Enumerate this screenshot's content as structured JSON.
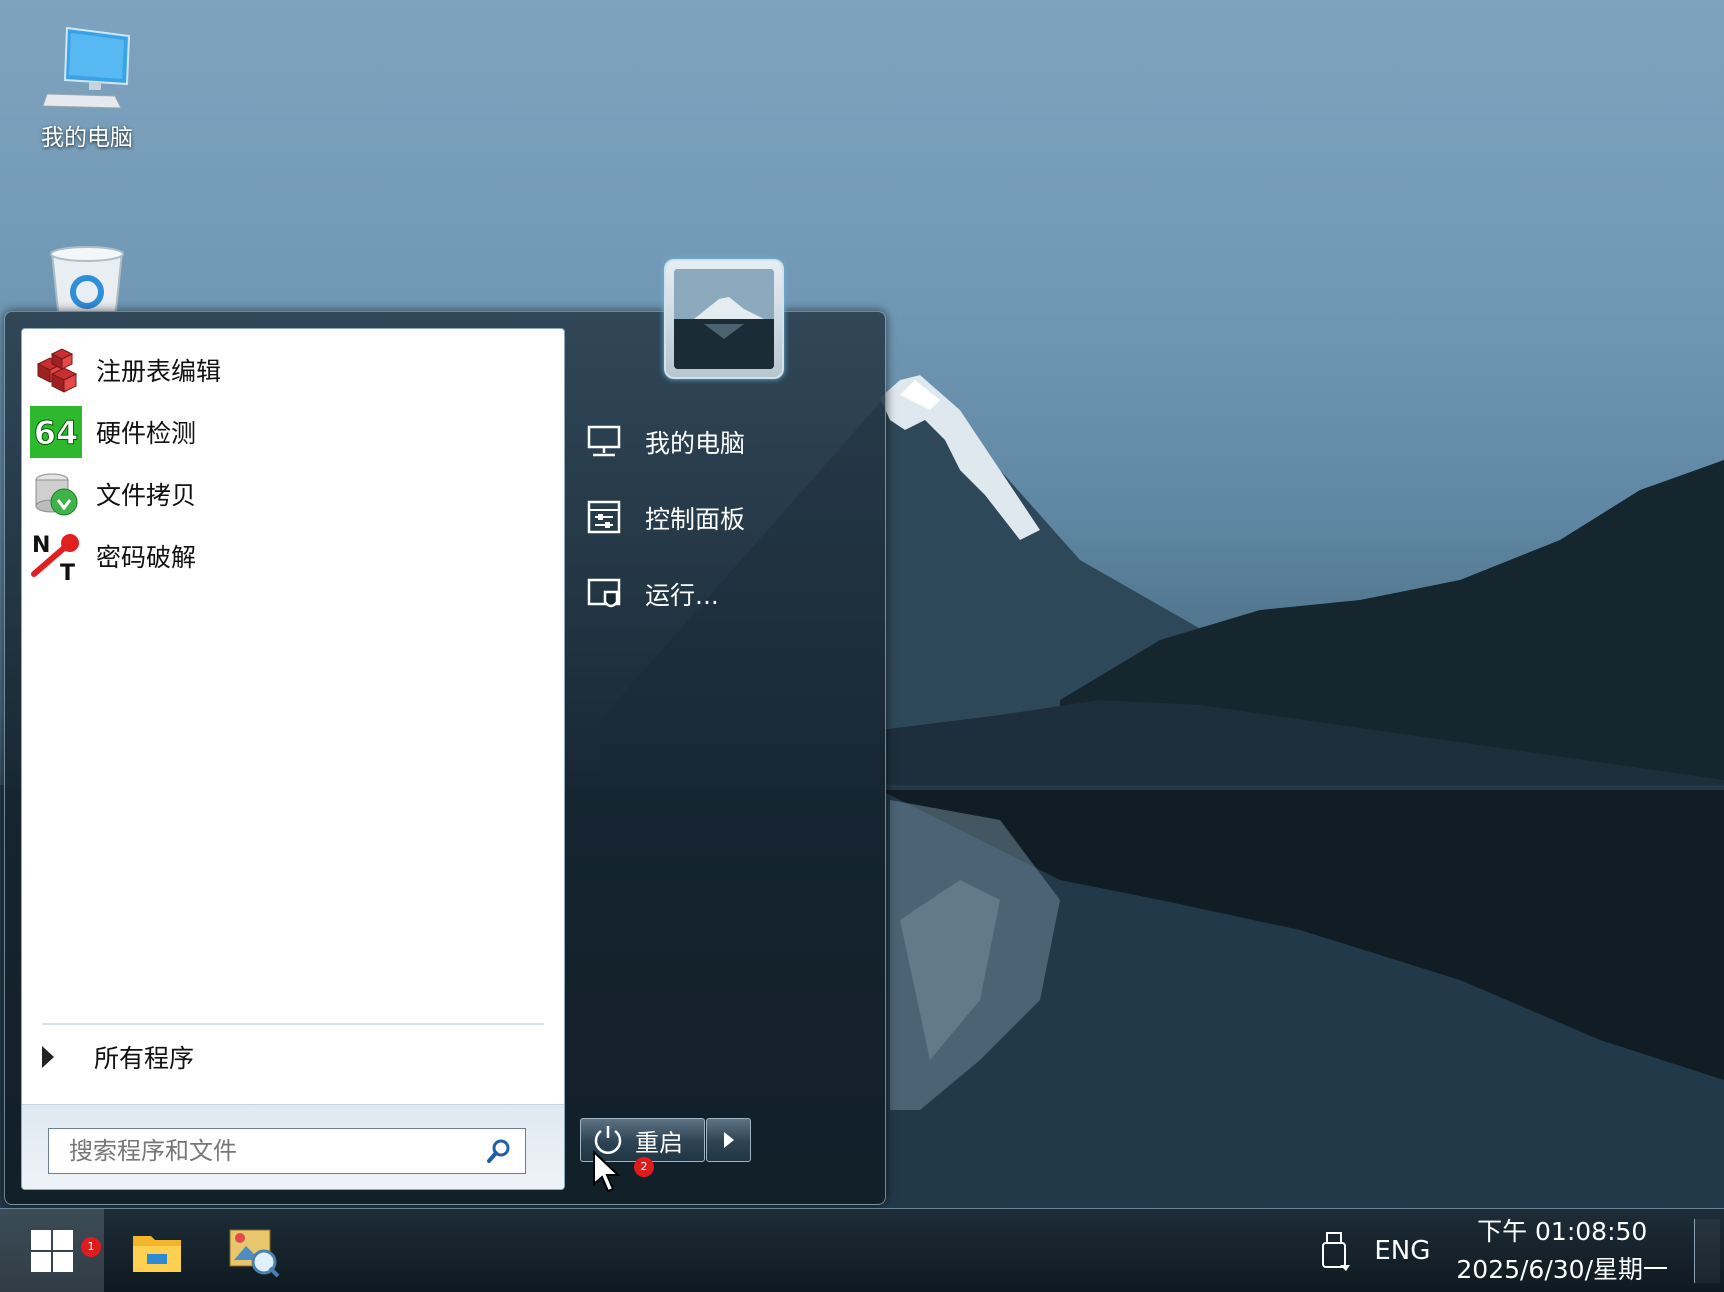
{
  "desktop": {
    "icons": [
      {
        "label": "我的电脑",
        "icon": "computer-icon"
      },
      {
        "label": "",
        "icon": "recycle-bin-icon"
      }
    ]
  },
  "start_menu": {
    "pinned_apps": [
      {
        "label": "注册表编辑",
        "icon": "registry-editor-icon"
      },
      {
        "label": "硬件检测",
        "icon": "aida64-icon"
      },
      {
        "label": "文件拷贝",
        "icon": "file-copy-icon"
      },
      {
        "label": "密码破解",
        "icon": "password-crack-icon"
      }
    ],
    "all_programs_label": "所有程序",
    "search_placeholder": "搜索程序和文件",
    "right_items": [
      {
        "label": "我的电脑",
        "icon": "computer-icon"
      },
      {
        "label": "控制面板",
        "icon": "control-panel-icon"
      },
      {
        "label": "运行...",
        "icon": "run-icon"
      }
    ],
    "shutdown_label": "重启",
    "shutdown_badge": "2"
  },
  "taskbar": {
    "start_badge": "1",
    "apps": [
      {
        "icon": "file-explorer-icon"
      },
      {
        "icon": "image-viewer-icon"
      }
    ],
    "tray": {
      "language": "ENG",
      "time": "下午 01:08:50",
      "date": "2025/6/30/星期一"
    }
  },
  "colors": {
    "accent": "#1e3140",
    "badge": "#e01b1b",
    "aida_green": "#2eb82e"
  }
}
